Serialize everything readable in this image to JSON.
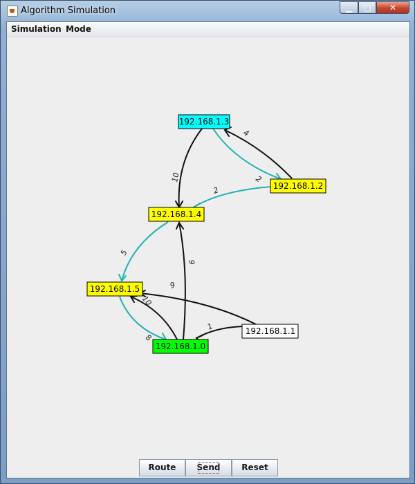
{
  "window": {
    "title": "Algorithm Simulation",
    "controls": {
      "minimize": "▁",
      "maximize": "□",
      "close": "✕"
    }
  },
  "menu": {
    "items": [
      "Simulation",
      "Mode"
    ]
  },
  "graph": {
    "nodes": [
      {
        "label": "192.168.1.3",
        "fill": "#00ffff"
      },
      {
        "label": "192.168.1.2",
        "fill": "#ffff00"
      },
      {
        "label": "192.168.1.4",
        "fill": "#ffff00"
      },
      {
        "label": "192.168.1.5",
        "fill": "#ffff00"
      },
      {
        "label": "192.168.1.0",
        "fill": "#00ff00"
      },
      {
        "label": "192.168.1.1",
        "fill": "#ffffff"
      }
    ],
    "edge_colors": {
      "normal": "#111111",
      "highlighted": "#1fb2b0"
    },
    "edge_weights": [
      "4",
      "2",
      "10",
      "2",
      "5",
      "9",
      "9",
      "10",
      "1",
      "8"
    ]
  },
  "buttons": {
    "route": "Route",
    "send": "Send",
    "reset": "Reset"
  }
}
